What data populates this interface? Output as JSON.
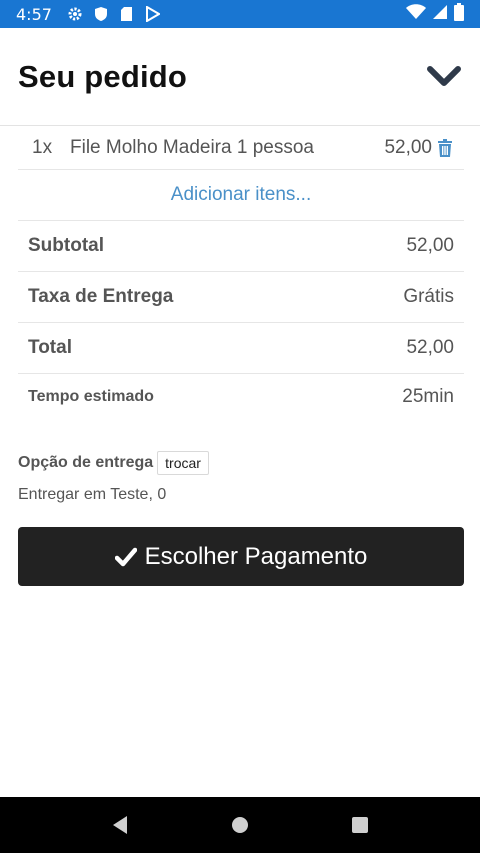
{
  "statusbar": {
    "time": "4:57",
    "icons": [
      "settings-icon",
      "shield-icon",
      "sd-card-icon",
      "play-store-icon"
    ],
    "right_icons": [
      "wifi-icon",
      "signal-icon",
      "battery-icon"
    ]
  },
  "header": {
    "title": "Seu pedido",
    "collapse_icon": "chevron-down-icon"
  },
  "order": {
    "items": [
      {
        "qty": "1x",
        "name": "File Molho Madeira 1 pessoa",
        "price": "52,00",
        "delete_icon": "trash-icon"
      }
    ],
    "add_items_label": "Adicionar itens..."
  },
  "summary": {
    "subtotal_label": "Subtotal",
    "subtotal_value": "52,00",
    "fee_label": "Taxa de Entrega",
    "fee_value": "Grátis",
    "total_label": "Total",
    "total_value": "52,00",
    "time_label": "Tempo estimado",
    "time_value": "25min"
  },
  "delivery": {
    "option_label": "Opção de entrega",
    "change_label": "trocar",
    "address": "Entregar em Teste, 0"
  },
  "payment": {
    "button_label": "Escolher Pagamento",
    "icon": "check-icon"
  },
  "navbar": {
    "buttons": [
      "back-icon",
      "home-icon",
      "recents-icon"
    ]
  },
  "colors": {
    "statusbar": "#1976d2",
    "link": "#4a90c8",
    "button": "#222222",
    "trash": "#4a90c8"
  }
}
